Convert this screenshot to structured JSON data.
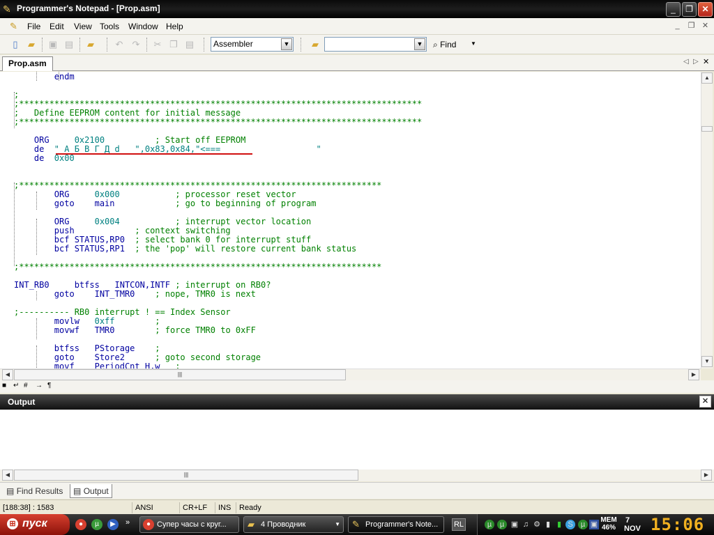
{
  "window": {
    "title": "Programmer's Notepad - [Prop.asm]",
    "controls": [
      "_",
      "❐",
      "✕"
    ]
  },
  "menu": [
    "File",
    "Edit",
    "View",
    "Tools",
    "Window",
    "Help"
  ],
  "toolbar": {
    "scheme_value": "Assembler",
    "search_value": "",
    "find_label": "Find"
  },
  "document_tab": "Prop.asm",
  "editor": {
    "lines": [
      {
        "i": 0,
        "parts": [
          [
            "k",
            "        endm"
          ]
        ]
      },
      {
        "i": 2,
        "parts": [
          [
            "c",
            ";"
          ]
        ]
      },
      {
        "i": 3,
        "parts": [
          [
            "c",
            ";********************************************************************************"
          ]
        ]
      },
      {
        "i": 4,
        "parts": [
          [
            "c",
            ";   Define EEPROM content for initial message"
          ]
        ]
      },
      {
        "i": 5,
        "parts": [
          [
            "c",
            ";********************************************************************************"
          ]
        ]
      },
      {
        "i": 7,
        "parts": [
          [
            "k",
            "    ORG     "
          ],
          [
            "n",
            "0x2100"
          ],
          [
            "c",
            "          ; Start off EEPROM"
          ]
        ]
      },
      {
        "i": 8,
        "parts": [
          [
            "k",
            "    de  "
          ],
          [
            "s",
            "\" А Б В Г Д d   \",0x83,0x84,\"<===                   \""
          ]
        ]
      },
      {
        "i": 9,
        "parts": [
          [
            "k",
            "    de  "
          ],
          [
            "n",
            "0x00"
          ]
        ]
      },
      {
        "i": 12,
        "parts": [
          [
            "c",
            ";************************************************************************"
          ]
        ]
      },
      {
        "i": 13,
        "parts": [
          [
            "k",
            "        ORG     "
          ],
          [
            "n",
            "0x000"
          ],
          [
            "c",
            "           ; processor reset vector"
          ]
        ]
      },
      {
        "i": 14,
        "parts": [
          [
            "k",
            "        goto    main            "
          ],
          [
            "c",
            "; go to beginning of program"
          ]
        ]
      },
      {
        "i": 16,
        "parts": [
          [
            "k",
            "        ORG     "
          ],
          [
            "n",
            "0x004"
          ],
          [
            "c",
            "           ; interrupt vector location"
          ]
        ]
      },
      {
        "i": 17,
        "parts": [
          [
            "k",
            "        push    "
          ],
          [
            "c",
            "        ; context switching"
          ]
        ]
      },
      {
        "i": 18,
        "parts": [
          [
            "k",
            "        bcf STATUS,RP0  "
          ],
          [
            "c",
            "; select bank 0 for interrupt stuff"
          ]
        ]
      },
      {
        "i": 19,
        "parts": [
          [
            "k",
            "        bcf STATUS,RP1  "
          ],
          [
            "c",
            "; the 'pop' will restore current bank status"
          ]
        ]
      },
      {
        "i": 21,
        "parts": [
          [
            "c",
            ";************************************************************************"
          ]
        ]
      },
      {
        "i": 23,
        "parts": [
          [
            "k",
            "INT_RB0     btfss   INTCON,INTF "
          ],
          [
            "c",
            "; interrupt on RB0?"
          ]
        ]
      },
      {
        "i": 24,
        "parts": [
          [
            "k",
            "        goto    INT_TMR0    "
          ],
          [
            "c",
            "; nope, TMR0 is next"
          ]
        ]
      },
      {
        "i": 26,
        "parts": [
          [
            "c",
            ";---------- RB0 interrupt ! == Index Sensor"
          ]
        ]
      },
      {
        "i": 27,
        "parts": [
          [
            "k",
            "        movlw   "
          ],
          [
            "n",
            "0xff"
          ],
          [
            "c",
            "        ;"
          ]
        ]
      },
      {
        "i": 28,
        "parts": [
          [
            "k",
            "        movwf   TMR0        "
          ],
          [
            "c",
            "; force TMR0 to 0xFF"
          ]
        ]
      },
      {
        "i": 30,
        "parts": [
          [
            "k",
            "        btfss   PStorage    "
          ],
          [
            "c",
            ";"
          ]
        ]
      },
      {
        "i": 31,
        "parts": [
          [
            "k",
            "        goto    Store2      "
          ],
          [
            "c",
            "; goto second storage"
          ]
        ]
      },
      {
        "i": 32,
        "parts": [
          [
            "k",
            "        movf    PeriodCnt_H,w   "
          ],
          [
            "c",
            ";"
          ]
        ]
      }
    ]
  },
  "output_panel": {
    "title": "Output",
    "tabs": [
      "Find Results",
      "Output"
    ]
  },
  "statusbar": {
    "position": "[188:38] : 1583",
    "encoding": "ANSI",
    "line_endings": "CR+LF",
    "insert_mode": "INS",
    "state": "Ready"
  },
  "taskbar": {
    "start_label": "пуск",
    "tasks": [
      "Супер часы с круг...",
      "4 Проводник",
      "Programmer's Note..."
    ],
    "language": "RL",
    "memory": "МЕМ 46%",
    "date_day": "7",
    "date_month": "NOV",
    "clock": "15:06"
  },
  "colors": {
    "keyword": "#0000a0",
    "number": "#008080",
    "comment": "#008000",
    "annotation_underline": "#d01010"
  }
}
